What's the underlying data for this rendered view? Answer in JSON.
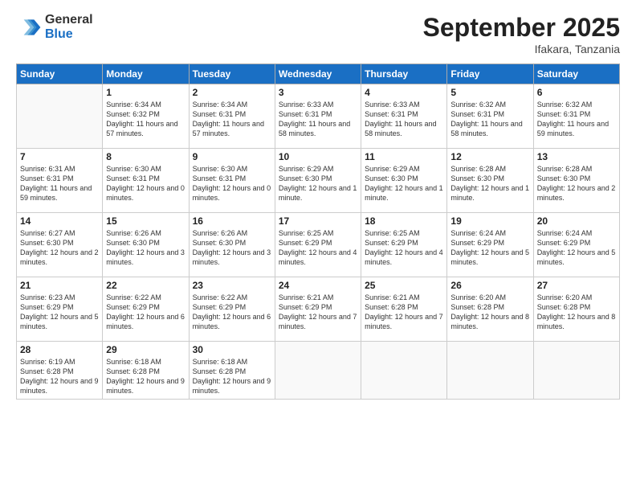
{
  "logo": {
    "general": "General",
    "blue": "Blue"
  },
  "title": "September 2025",
  "location": "Ifakara, Tanzania",
  "days_header": [
    "Sunday",
    "Monday",
    "Tuesday",
    "Wednesday",
    "Thursday",
    "Friday",
    "Saturday"
  ],
  "weeks": [
    [
      {
        "day": "",
        "sunrise": "",
        "sunset": "",
        "daylight": ""
      },
      {
        "day": "1",
        "sunrise": "Sunrise: 6:34 AM",
        "sunset": "Sunset: 6:32 PM",
        "daylight": "Daylight: 11 hours and 57 minutes."
      },
      {
        "day": "2",
        "sunrise": "Sunrise: 6:34 AM",
        "sunset": "Sunset: 6:31 PM",
        "daylight": "Daylight: 11 hours and 57 minutes."
      },
      {
        "day": "3",
        "sunrise": "Sunrise: 6:33 AM",
        "sunset": "Sunset: 6:31 PM",
        "daylight": "Daylight: 11 hours and 58 minutes."
      },
      {
        "day": "4",
        "sunrise": "Sunrise: 6:33 AM",
        "sunset": "Sunset: 6:31 PM",
        "daylight": "Daylight: 11 hours and 58 minutes."
      },
      {
        "day": "5",
        "sunrise": "Sunrise: 6:32 AM",
        "sunset": "Sunset: 6:31 PM",
        "daylight": "Daylight: 11 hours and 58 minutes."
      },
      {
        "day": "6",
        "sunrise": "Sunrise: 6:32 AM",
        "sunset": "Sunset: 6:31 PM",
        "daylight": "Daylight: 11 hours and 59 minutes."
      }
    ],
    [
      {
        "day": "7",
        "sunrise": "Sunrise: 6:31 AM",
        "sunset": "Sunset: 6:31 PM",
        "daylight": "Daylight: 11 hours and 59 minutes."
      },
      {
        "day": "8",
        "sunrise": "Sunrise: 6:30 AM",
        "sunset": "Sunset: 6:31 PM",
        "daylight": "Daylight: 12 hours and 0 minutes."
      },
      {
        "day": "9",
        "sunrise": "Sunrise: 6:30 AM",
        "sunset": "Sunset: 6:31 PM",
        "daylight": "Daylight: 12 hours and 0 minutes."
      },
      {
        "day": "10",
        "sunrise": "Sunrise: 6:29 AM",
        "sunset": "Sunset: 6:30 PM",
        "daylight": "Daylight: 12 hours and 1 minute."
      },
      {
        "day": "11",
        "sunrise": "Sunrise: 6:29 AM",
        "sunset": "Sunset: 6:30 PM",
        "daylight": "Daylight: 12 hours and 1 minute."
      },
      {
        "day": "12",
        "sunrise": "Sunrise: 6:28 AM",
        "sunset": "Sunset: 6:30 PM",
        "daylight": "Daylight: 12 hours and 1 minute."
      },
      {
        "day": "13",
        "sunrise": "Sunrise: 6:28 AM",
        "sunset": "Sunset: 6:30 PM",
        "daylight": "Daylight: 12 hours and 2 minutes."
      }
    ],
    [
      {
        "day": "14",
        "sunrise": "Sunrise: 6:27 AM",
        "sunset": "Sunset: 6:30 PM",
        "daylight": "Daylight: 12 hours and 2 minutes."
      },
      {
        "day": "15",
        "sunrise": "Sunrise: 6:26 AM",
        "sunset": "Sunset: 6:30 PM",
        "daylight": "Daylight: 12 hours and 3 minutes."
      },
      {
        "day": "16",
        "sunrise": "Sunrise: 6:26 AM",
        "sunset": "Sunset: 6:30 PM",
        "daylight": "Daylight: 12 hours and 3 minutes."
      },
      {
        "day": "17",
        "sunrise": "Sunrise: 6:25 AM",
        "sunset": "Sunset: 6:29 PM",
        "daylight": "Daylight: 12 hours and 4 minutes."
      },
      {
        "day": "18",
        "sunrise": "Sunrise: 6:25 AM",
        "sunset": "Sunset: 6:29 PM",
        "daylight": "Daylight: 12 hours and 4 minutes."
      },
      {
        "day": "19",
        "sunrise": "Sunrise: 6:24 AM",
        "sunset": "Sunset: 6:29 PM",
        "daylight": "Daylight: 12 hours and 5 minutes."
      },
      {
        "day": "20",
        "sunrise": "Sunrise: 6:24 AM",
        "sunset": "Sunset: 6:29 PM",
        "daylight": "Daylight: 12 hours and 5 minutes."
      }
    ],
    [
      {
        "day": "21",
        "sunrise": "Sunrise: 6:23 AM",
        "sunset": "Sunset: 6:29 PM",
        "daylight": "Daylight: 12 hours and 5 minutes."
      },
      {
        "day": "22",
        "sunrise": "Sunrise: 6:22 AM",
        "sunset": "Sunset: 6:29 PM",
        "daylight": "Daylight: 12 hours and 6 minutes."
      },
      {
        "day": "23",
        "sunrise": "Sunrise: 6:22 AM",
        "sunset": "Sunset: 6:29 PM",
        "daylight": "Daylight: 12 hours and 6 minutes."
      },
      {
        "day": "24",
        "sunrise": "Sunrise: 6:21 AM",
        "sunset": "Sunset: 6:29 PM",
        "daylight": "Daylight: 12 hours and 7 minutes."
      },
      {
        "day": "25",
        "sunrise": "Sunrise: 6:21 AM",
        "sunset": "Sunset: 6:28 PM",
        "daylight": "Daylight: 12 hours and 7 minutes."
      },
      {
        "day": "26",
        "sunrise": "Sunrise: 6:20 AM",
        "sunset": "Sunset: 6:28 PM",
        "daylight": "Daylight: 12 hours and 8 minutes."
      },
      {
        "day": "27",
        "sunrise": "Sunrise: 6:20 AM",
        "sunset": "Sunset: 6:28 PM",
        "daylight": "Daylight: 12 hours and 8 minutes."
      }
    ],
    [
      {
        "day": "28",
        "sunrise": "Sunrise: 6:19 AM",
        "sunset": "Sunset: 6:28 PM",
        "daylight": "Daylight: 12 hours and 9 minutes."
      },
      {
        "day": "29",
        "sunrise": "Sunrise: 6:18 AM",
        "sunset": "Sunset: 6:28 PM",
        "daylight": "Daylight: 12 hours and 9 minutes."
      },
      {
        "day": "30",
        "sunrise": "Sunrise: 6:18 AM",
        "sunset": "Sunset: 6:28 PM",
        "daylight": "Daylight: 12 hours and 9 minutes."
      },
      {
        "day": "",
        "sunrise": "",
        "sunset": "",
        "daylight": ""
      },
      {
        "day": "",
        "sunrise": "",
        "sunset": "",
        "daylight": ""
      },
      {
        "day": "",
        "sunrise": "",
        "sunset": "",
        "daylight": ""
      },
      {
        "day": "",
        "sunrise": "",
        "sunset": "",
        "daylight": ""
      }
    ]
  ]
}
